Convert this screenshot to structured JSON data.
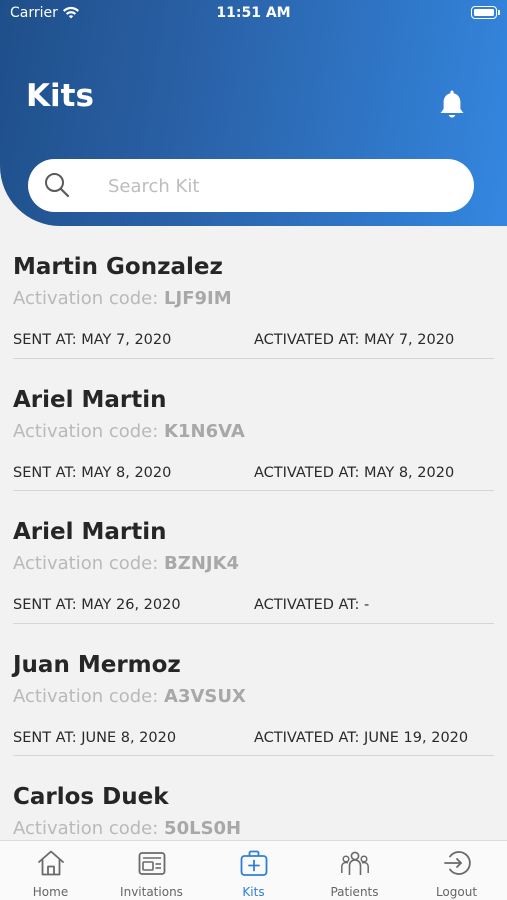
{
  "status_bar": {
    "carrier": "Carrier",
    "time": "11:51 AM"
  },
  "header": {
    "title": "Kits",
    "bell_icon": "bell-icon",
    "gradient_start": "#1f4f8a",
    "gradient_end": "#3487e0"
  },
  "search": {
    "placeholder": "Search Kit",
    "value": ""
  },
  "kits": [
    {
      "name": "Martin Gonzalez",
      "code_label": "Activation code:",
      "code": "LJF9IM",
      "sent": "SENT AT: MAY 7, 2020",
      "activated": "ACTIVATED AT: MAY 7, 2020"
    },
    {
      "name": "Ariel Martin",
      "code_label": "Activation code:",
      "code": "K1N6VA",
      "sent": "SENT AT: MAY 8, 2020",
      "activated": "ACTIVATED AT: MAY 8, 2020"
    },
    {
      "name": "Ariel Martin",
      "code_label": "Activation code:",
      "code": "BZNJK4",
      "sent": "SENT AT: MAY 26, 2020",
      "activated": "ACTIVATED AT: -"
    },
    {
      "name": "Juan Mermoz",
      "code_label": "Activation code:",
      "code": "A3VSUX",
      "sent": "SENT AT: JUNE 8, 2020",
      "activated": "ACTIVATED AT: JUNE 19, 2020"
    },
    {
      "name": "Carlos Duek",
      "code_label": "Activation code:",
      "code": "50LS0H",
      "sent": "",
      "activated": ""
    }
  ],
  "tabbar": {
    "active_color": "#2f7fd6",
    "items": [
      {
        "label": "Home",
        "icon": "home-icon"
      },
      {
        "label": "Invitations",
        "icon": "invitations-icon"
      },
      {
        "label": "Kits",
        "icon": "kit-icon"
      },
      {
        "label": "Patients",
        "icon": "patients-icon"
      },
      {
        "label": "Logout",
        "icon": "logout-icon"
      }
    ]
  }
}
